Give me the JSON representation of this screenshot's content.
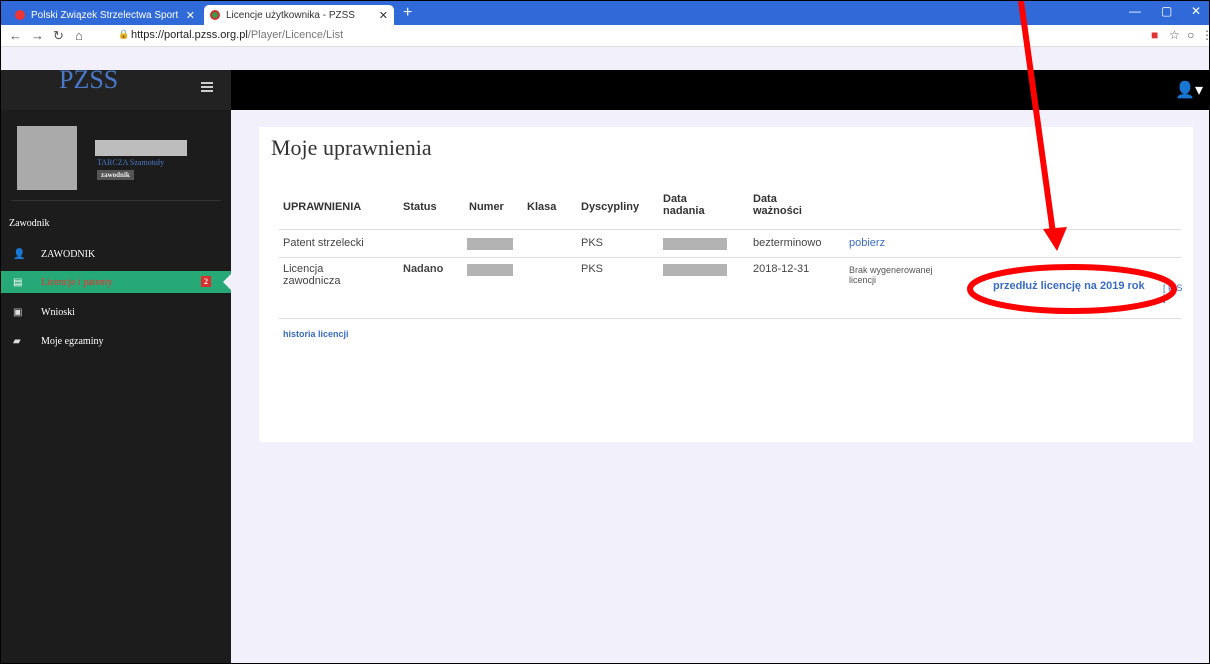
{
  "browser": {
    "tabs": [
      {
        "title": "Polski Związek Strzelectwa Sport",
        "close": "✕"
      },
      {
        "title": "Licencje użytkownika - PZSS",
        "close": "✕"
      }
    ],
    "new_tab": "+",
    "url_domain": "https://portal.pzss.org.pl",
    "url_path": "/Player/Licence/List"
  },
  "sidebar": {
    "logo": "PZSS",
    "user_name": "TARCZA Szamotuły",
    "user_role": "zawodnik",
    "section": "Zawodnik",
    "items": [
      {
        "label": "ZAWODNIK"
      },
      {
        "label": "Licencje i patenty",
        "badge": "2"
      },
      {
        "label": "Wnioski"
      },
      {
        "label": "Moje egzaminy"
      }
    ]
  },
  "main": {
    "title": "Moje uprawnienia",
    "columns": [
      "UPRAWNIENIA",
      "Status",
      "Numer",
      "Klasa",
      "Dyscypliny",
      "Data nadania",
      "Data ważności"
    ],
    "rows": [
      {
        "name": "Patent strzelecki",
        "status": "",
        "dyscypliny": "PKS",
        "waznosc": "bezterminowo",
        "action": "pobierz"
      },
      {
        "name": "Licencja zawodnicza",
        "status": "Nadano",
        "dyscypliny": "PKS",
        "waznosc": "2018-12-31",
        "note": "Brak wygenerowanej licencji",
        "action": "przedłuż licencję na 2019 rok",
        "extra": "[ P S ]"
      }
    ],
    "history": "historia licencji"
  },
  "colors": {
    "accent": "#26a877",
    "link": "#3a6cc0",
    "annotation": "#ff0000"
  }
}
